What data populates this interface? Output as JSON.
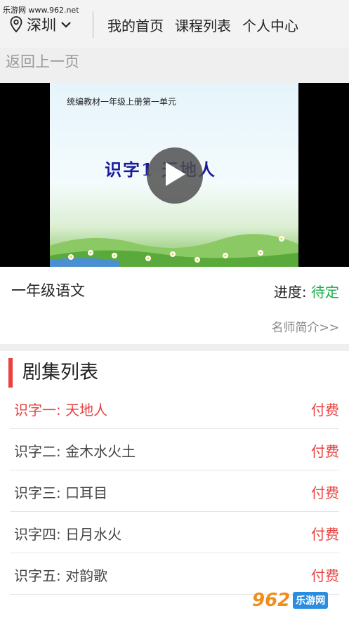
{
  "watermark": {
    "site": "乐游网 www.962.net"
  },
  "header": {
    "city": "深圳",
    "nav": [
      "我的首页",
      "课程列表",
      "个人中心"
    ]
  },
  "back_label": "返回上一页",
  "video": {
    "slide_subtitle": "统编教材一年级上册第一单元",
    "slide_title": "识字1 天地人"
  },
  "course": {
    "name": "一年级语文",
    "progress_label": "进度:",
    "progress_status": "待定",
    "teacher_link": "名师简介>>"
  },
  "episodes": {
    "header": "剧集列表",
    "items": [
      {
        "title": "识字一:  天地人",
        "price": "付费",
        "active": true
      },
      {
        "title": "识字二:  金木水火土",
        "price": "付费",
        "active": false
      },
      {
        "title": "识字三:  口耳目",
        "price": "付费",
        "active": false
      },
      {
        "title": "识字四:  日月水火",
        "price": "付费",
        "active": false
      },
      {
        "title": "识字五:  对韵歌",
        "price": "付费",
        "active": false
      }
    ]
  },
  "logo": {
    "number": "962",
    "text": "乐游网"
  },
  "colors": {
    "accent_red": "#e8413e",
    "status_green": "#1fae4c"
  }
}
